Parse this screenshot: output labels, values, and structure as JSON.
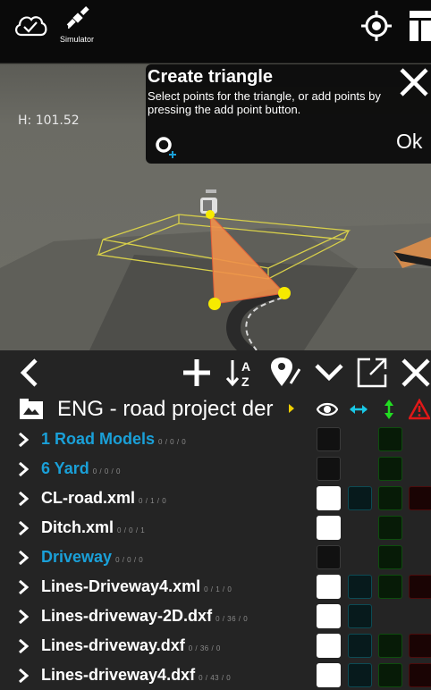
{
  "topbar": {
    "simulator_label": "Simulator"
  },
  "viewport": {
    "height_readout": "H: 101.52"
  },
  "dialog": {
    "title": "Create triangle",
    "description": "Select points for the triangle, or add points by pressing the add point button.",
    "ok_label": "Ok"
  },
  "panel": {
    "project_name": "ENG - road project der"
  },
  "colors": {
    "accent_blue": "#1aa0d8",
    "cyan_arrow": "#19c8e6",
    "green_arrow": "#22dd22",
    "warning_red": "#e01818",
    "triangle_orange": "#f0904a",
    "point_yellow": "#f6ea00"
  },
  "layers": [
    {
      "name": "1 Road Models",
      "count": "0 / 0 / 0",
      "color": "blue",
      "visible": false,
      "select": false,
      "grade": true,
      "warn": false
    },
    {
      "name": "6 Yard",
      "count": "0 / 0 / 0",
      "color": "blue",
      "visible": false,
      "select": false,
      "grade": true,
      "warn": false
    },
    {
      "name": "CL-road.xml",
      "count": "0 / 1 / 0",
      "color": "white",
      "visible": true,
      "select": true,
      "grade": true,
      "warn": true
    },
    {
      "name": "Ditch.xml",
      "count": "0 / 0 / 1",
      "color": "white",
      "visible": true,
      "select": false,
      "grade": true,
      "warn": false
    },
    {
      "name": "Driveway",
      "count": "0 / 0 / 0",
      "color": "blue",
      "visible": false,
      "select": false,
      "grade": true,
      "warn": false
    },
    {
      "name": "Lines-Driveway4.xml",
      "count": "0 / 1 / 0",
      "color": "white",
      "visible": true,
      "select": true,
      "grade": true,
      "warn": true
    },
    {
      "name": "Lines-driveway-2D.dxf",
      "count": "0 / 36 / 0",
      "color": "white",
      "visible": true,
      "select": true,
      "grade": false,
      "warn": false
    },
    {
      "name": "Lines-driveway.dxf",
      "count": "0 / 36 / 0",
      "color": "white",
      "visible": true,
      "select": true,
      "grade": true,
      "warn": true
    },
    {
      "name": "Lines-driveway4.dxf",
      "count": "0 / 43 / 0",
      "color": "white",
      "visible": true,
      "select": true,
      "grade": true,
      "warn": true
    }
  ]
}
